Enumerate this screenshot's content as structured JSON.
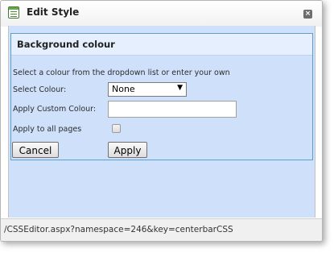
{
  "window": {
    "title": "Edit Style",
    "close_glyph": "×",
    "title_icon": "stylesheet-icon"
  },
  "panel": {
    "header": "Background colour",
    "instructions": "Select a colour from the dropdown list or enter your own",
    "select_colour_label": "Select Colour:",
    "select_colour_value": "None",
    "custom_colour_label": "Apply Custom Colour:",
    "custom_colour_value": "",
    "apply_all_label": "Apply to all pages",
    "apply_all_checked": false,
    "cancel_label": "Cancel",
    "apply_label": "Apply"
  },
  "status": {
    "url": "/CSSEditor.aspx?namespace=246&key=centerbarCSS"
  },
  "colors": {
    "body_bg": "#cfe0fb",
    "panel_border": "#5b9fd4",
    "header_bg": "#e5effd"
  }
}
